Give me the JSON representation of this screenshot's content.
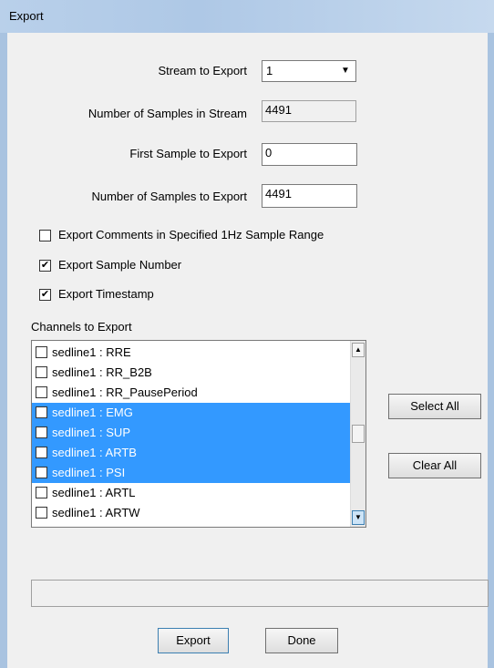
{
  "window": {
    "title": "Export"
  },
  "stream": {
    "label": "Stream to Export",
    "value": "1"
  },
  "num_samples_stream": {
    "label": "Number of Samples in Stream",
    "value": "4491"
  },
  "first_sample": {
    "label": "First Sample to Export",
    "value": "0"
  },
  "num_samples_export": {
    "label": "Number of Samples to Export",
    "value": "4491"
  },
  "options": [
    {
      "label": "Export Comments in Specified 1Hz Sample Range",
      "checked": false
    },
    {
      "label": "Export Sample Number",
      "checked": true
    },
    {
      "label": "Export Timestamp",
      "checked": true
    }
  ],
  "channels": {
    "label": "Channels to Export",
    "items": [
      {
        "label": "sedline1 : RRE",
        "checked": false,
        "selected": false
      },
      {
        "label": "sedline1 : RR_B2B",
        "checked": false,
        "selected": false
      },
      {
        "label": "sedline1 : RR_PausePeriod",
        "checked": false,
        "selected": false
      },
      {
        "label": "sedline1 : EMG",
        "checked": true,
        "selected": true
      },
      {
        "label": "sedline1 : SUP",
        "checked": true,
        "selected": true
      },
      {
        "label": "sedline1 : ARTB",
        "checked": true,
        "selected": true
      },
      {
        "label": "sedline1 : PSI",
        "checked": true,
        "selected": true
      },
      {
        "label": "sedline1 : ARTL",
        "checked": false,
        "selected": false
      },
      {
        "label": "sedline1 : ARTW",
        "checked": false,
        "selected": false
      }
    ]
  },
  "buttons": {
    "select_all": "Select All",
    "clear_all": "Clear All",
    "export": "Export",
    "done": "Done"
  },
  "status_text": ""
}
